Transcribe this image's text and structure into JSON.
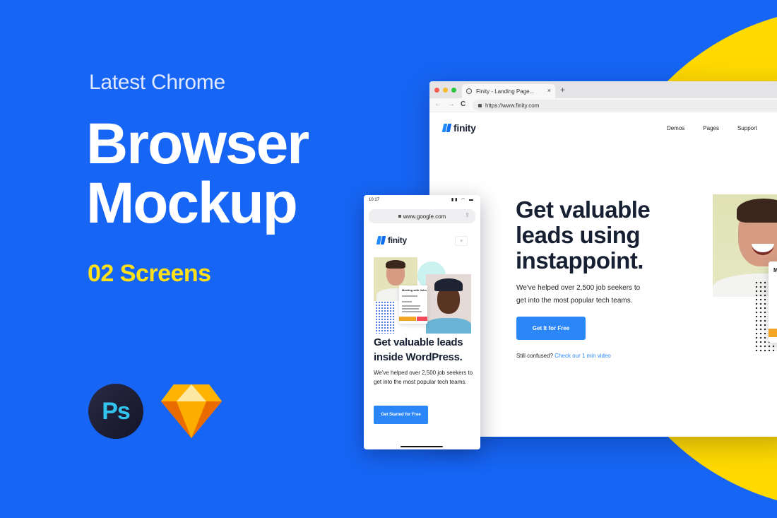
{
  "colors": {
    "background": "#1765f5",
    "accent_yellow": "#ffd900",
    "cta_blue": "#2b87f7",
    "heading_dark": "#172033"
  },
  "hero": {
    "kicker": "Latest Chrome",
    "title_line1": "Browser",
    "title_line2": "Mockup",
    "subtitle": "02 Screens",
    "apps": [
      {
        "name": "photoshop-icon",
        "label": "Ps"
      },
      {
        "name": "sketch-icon",
        "label": ""
      }
    ]
  },
  "browser": {
    "tab_title": "Finity - Landing Page...",
    "tab_close": "×",
    "new_tab": "+",
    "nav": {
      "back": "←",
      "forward": "→",
      "reload": "C"
    },
    "url": "https://www.finity.com",
    "site": {
      "logo": "finity",
      "links": [
        "Demos",
        "Pages",
        "Support"
      ],
      "headline_line1": "Get valuable",
      "headline_line2": "leads using",
      "headline_line3": "instappoint.",
      "body": "We've helped over 2,500 job seekers to get into the most popular tech teams.",
      "cta": "Get It for Free",
      "confused_text": "Still confused?",
      "confused_link": "Check our 1 min video",
      "card_title_initial": "M"
    }
  },
  "phone": {
    "time": "10:17",
    "status_icons": "▮▮ ◠ ▬",
    "url": "www.google.com",
    "share": "⇪",
    "logo": "finity",
    "menu": "≡",
    "card_title": "Meeting with John",
    "headline_line1": "Get valuable leads",
    "headline_line2": "inside WordPress.",
    "body": "We've helped over 2,500 job seekers to get into the most popular tech teams.",
    "cta": "Get Started for Free"
  }
}
